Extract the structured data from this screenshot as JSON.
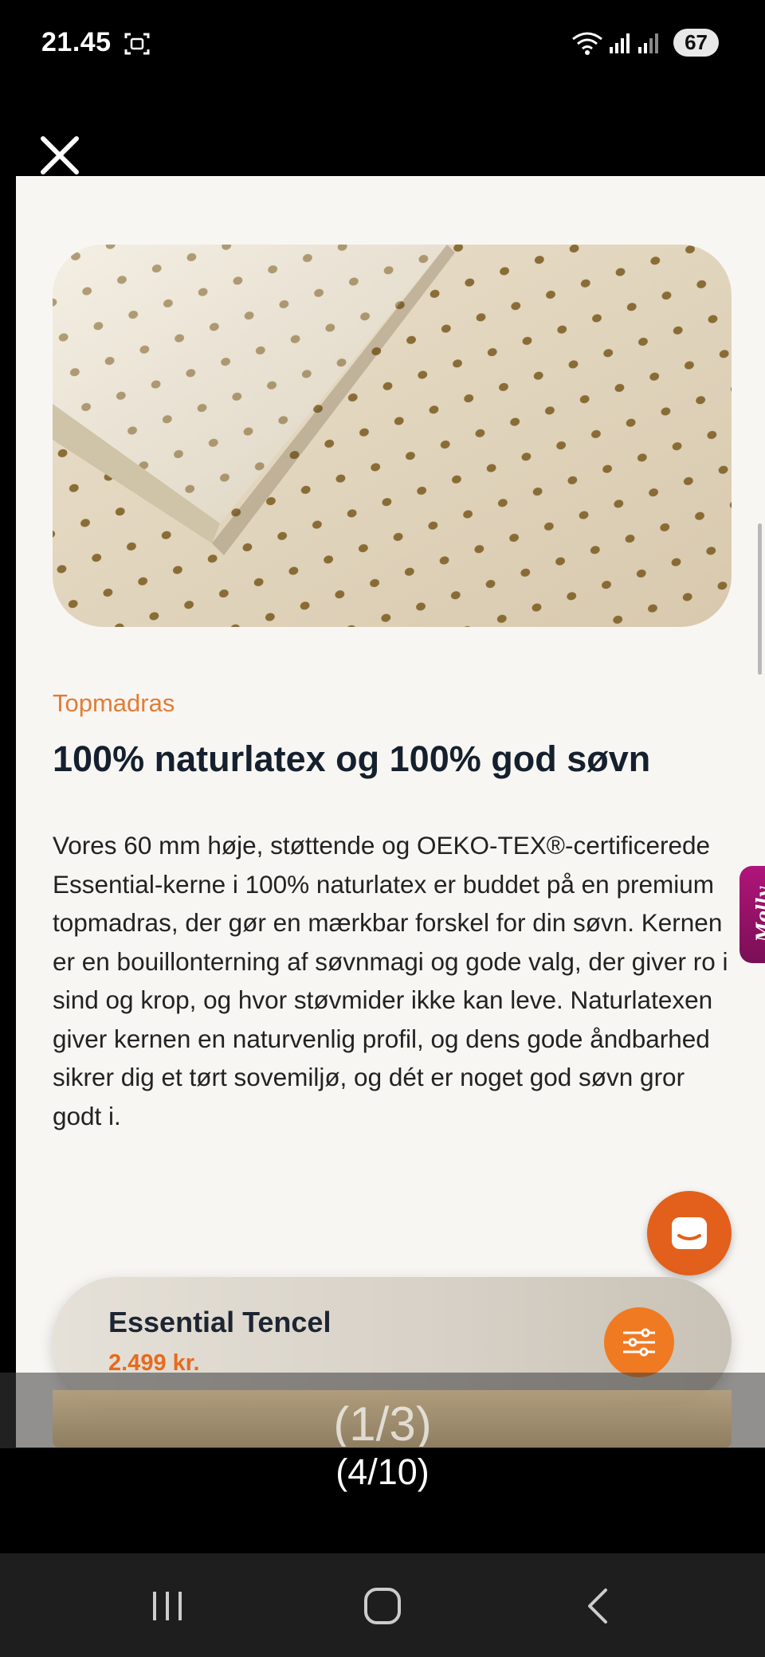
{
  "status_bar": {
    "time": "21.45",
    "battery": "67",
    "icons": [
      "screenshot-icon",
      "wifi-icon",
      "signal-icon",
      "signal-icon-2",
      "battery-icon"
    ]
  },
  "viewer": {
    "close_icon": "close-icon",
    "counter": "(4/10)",
    "sub_counter": "(1/3)"
  },
  "page": {
    "category": "Topmadras",
    "headline": "100% naturlatex og 100% god søvn",
    "body": "Vores 60 mm høje, støttende og OEKO-TEX®-certificerede Essential-kerne i 100% naturlatex er buddet på en premium topmadras, der gør en mærkbar forskel for din søvn. Kernen er en bouillonterning af søvnmagi og gode valg, der giver ro i sind og krop, og hvor støvmider ikke kan leve. Naturlatexen giver kernen en naturvenlig profil, og dens gode åndbarhed sikrer dig et tørt sovemiljø, og dét er noget god søvn gror godt i.",
    "side_tab": "Molly",
    "accent_color": "#e27c34"
  },
  "product_bar": {
    "name": "Essential Tencel",
    "price": "2.499 kr."
  },
  "nav": {
    "icons": [
      "recent-apps-icon",
      "home-icon",
      "back-icon"
    ]
  }
}
